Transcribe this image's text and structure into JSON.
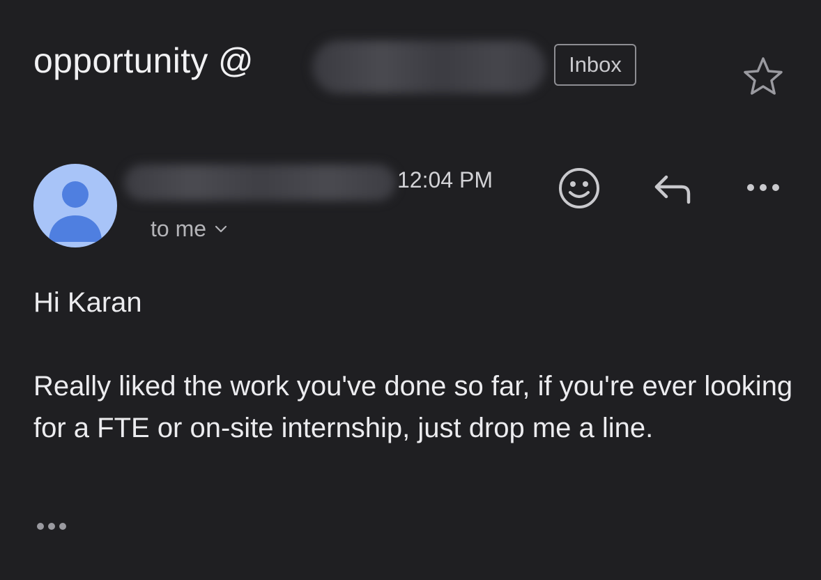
{
  "email": {
    "subject": "opportunity @",
    "label_badge": "Inbox",
    "sender": {
      "time": "12:04 PM",
      "recipient_text": "to me"
    },
    "body": {
      "greeting": "Hi Karan",
      "message": "Really liked the work you've done so far, if you're ever looking for a FTE or on-site internship, just drop me a line."
    }
  },
  "icons": {
    "star": "star-icon",
    "avatar": "person-icon",
    "recipient_toggle": "chevron-down-icon",
    "emoji": "smiley-icon",
    "reply": "reply-icon",
    "more": "more-horizontal-icon",
    "show_trimmed": "ellipsis-icon"
  },
  "colors": {
    "background": "#1f1f22",
    "avatar_bg": "#a8c4f8",
    "avatar_figure": "#4f7fe0"
  }
}
